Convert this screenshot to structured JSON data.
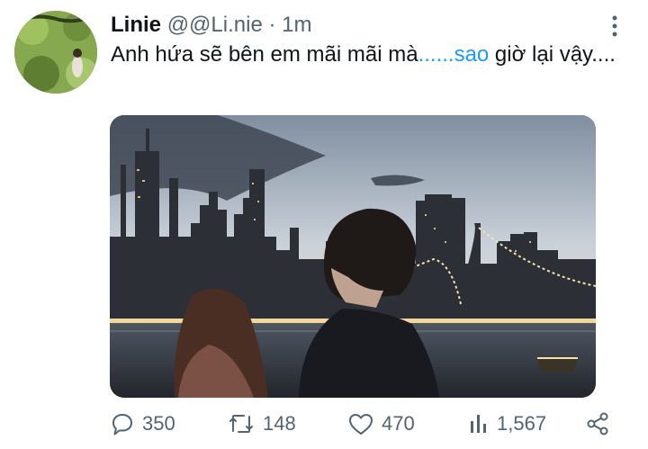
{
  "tweet": {
    "author_name": "Linie",
    "author_handle": "@@Li.nie",
    "separator": "·",
    "timestamp": "1m",
    "text_before_link": "Anh hứa sẽ bên em mãi mãi mà",
    "link_text": "......sao",
    "text_after_link": " giờ lại vậy...."
  },
  "actions": {
    "replies": "350",
    "retweets": "148",
    "likes": "470",
    "views": "1,567"
  },
  "colors": {
    "accent": "#1d9bf0",
    "secondary_text": "#536471",
    "primary_text": "#0f1419"
  },
  "icons": [
    "more-vertical-icon",
    "reply-icon",
    "retweet-icon",
    "like-icon",
    "views-icon",
    "share-icon"
  ]
}
